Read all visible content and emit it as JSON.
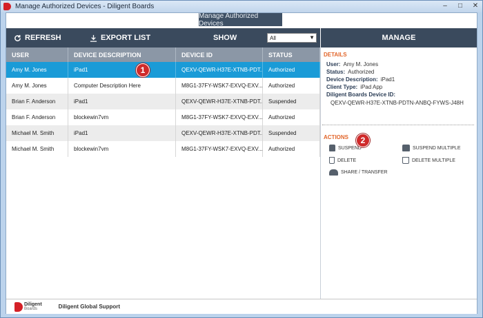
{
  "window": {
    "title": "Manage Authorized Devices - Diligent Boards",
    "controls": [
      "–",
      "□",
      "✕"
    ]
  },
  "header_tab": "Manage Authorized Devices",
  "toolbar": {
    "refresh": "REFRESH",
    "export": "EXPORT LIST",
    "show_label": "SHOW",
    "show_value": "All"
  },
  "manage": {
    "title": "MANAGE"
  },
  "table": {
    "headers": [
      "USER",
      "DEVICE DESCRIPTION",
      "DEVICE ID",
      "STATUS"
    ],
    "rows": [
      [
        "Amy M. Jones",
        "iPad1",
        "QEXV-QEWR-H37E-XTNB-PDT...",
        "Authorized"
      ],
      [
        "Amy M. Jones",
        "Computer Description Here",
        "M8G1-37FY-WSK7-EXVQ-EXV...",
        "Authorized"
      ],
      [
        "Brian F. Anderson",
        "iPad1",
        "QEXV-QEWR-H37E-XTNB-PDT...",
        "Suspended"
      ],
      [
        "Brian F. Anderson",
        "blockewin7vm",
        "M8G1-37FY-WSK7-EXVQ-EXV...",
        "Authorized"
      ],
      [
        "Michael M. Smith",
        "iPad1",
        "QEXV-QEWR-H37E-XTNB-PDT...",
        "Suspended"
      ],
      [
        "Michael M. Smith",
        "blockewin7vm",
        "M8G1-37FY-WSK7-EXVQ-EXV...",
        "Authorized"
      ]
    ],
    "selected_row": 0
  },
  "details": {
    "title": "DETAILS",
    "user_label": "User:",
    "user": "Amy M. Jones",
    "status_label": "Status:",
    "status": "Authorized",
    "desc_label": "Device Description:",
    "desc": "iPad1",
    "client_label": "Client Type:",
    "client": "iPad App",
    "devid_label": "Diligent Boards Device ID:",
    "devid": "QEXV-QEWR-H37E-XTNB-PDTN-ANBQ-FYWS-J48H"
  },
  "actions": {
    "title": "ACTIONS",
    "suspend": "SUSPEND",
    "suspend_multiple": "SUSPEND MULTIPLE",
    "delete": "DELETE",
    "delete_multiple": "DELETE MULTIPLE",
    "share": "SHARE / TRANSFER"
  },
  "badges": {
    "one": "1",
    "two": "2"
  },
  "footer": {
    "logo_name": "Diligent",
    "logo_sub": "Boards",
    "support": "Diligent Global Support"
  },
  "colors": {
    "accent": "#1a9bd7",
    "toolbar": "#3a4a5d",
    "section": "#e2662b",
    "badge": "#cf2a2a"
  }
}
